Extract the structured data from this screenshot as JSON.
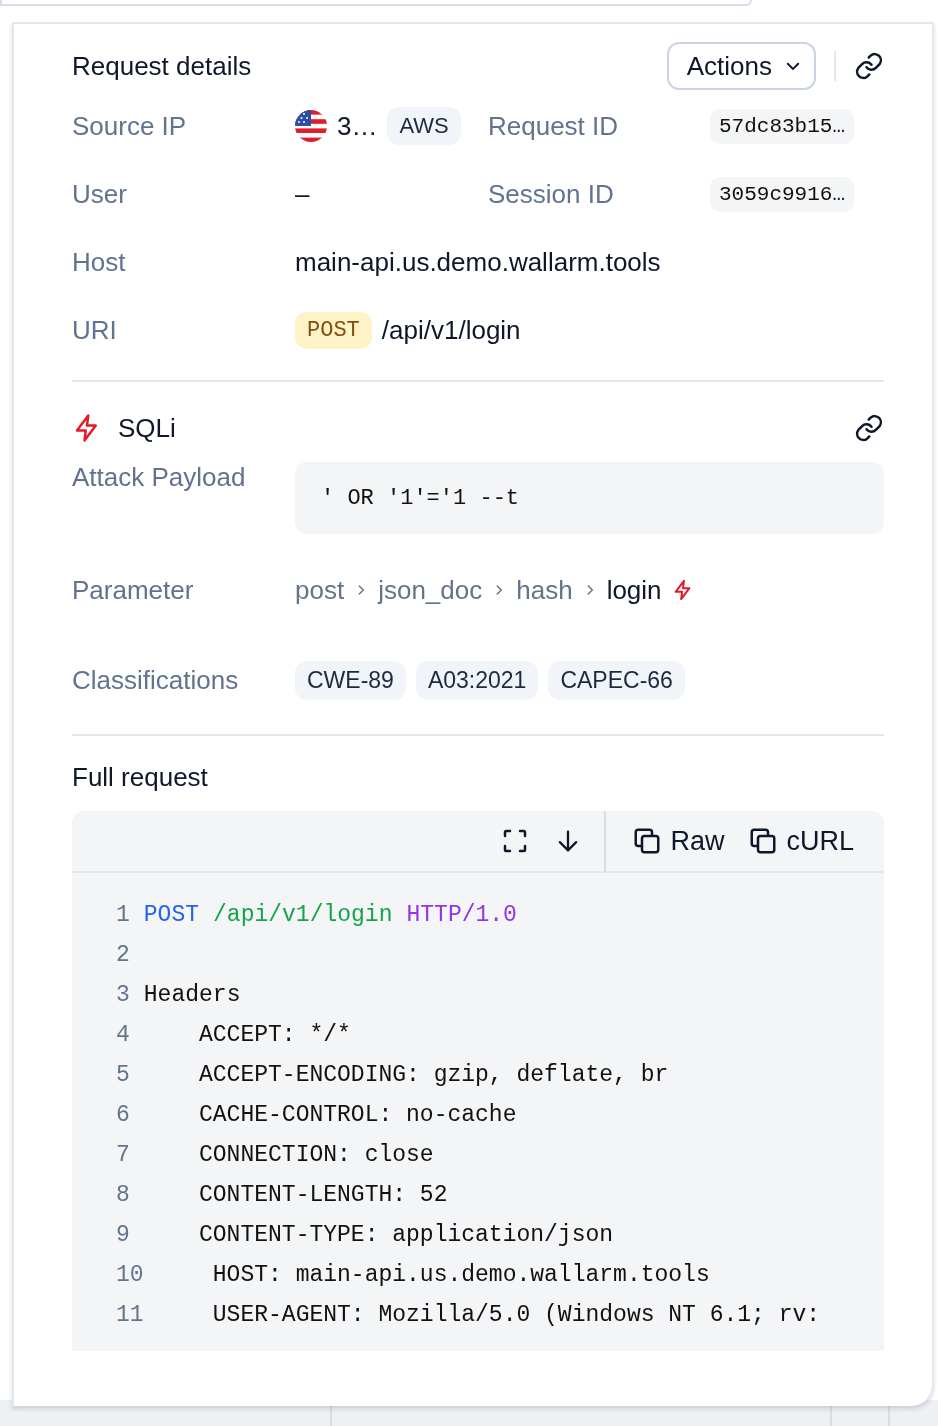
{
  "request_details": {
    "title": "Request details",
    "actions_button": "Actions"
  },
  "source_ip": {
    "label": "Source IP",
    "value": "3…",
    "provider": "AWS"
  },
  "request_id": {
    "label": "Request ID",
    "value": "57dc83b15…"
  },
  "user": {
    "label": "User",
    "value": "–"
  },
  "session_id": {
    "label": "Session ID",
    "value": "3059c9916…"
  },
  "host": {
    "label": "Host",
    "value": "main-api.us.demo.wallarm.tools"
  },
  "uri": {
    "label": "URI",
    "method": "POST",
    "path": "/api/v1/login"
  },
  "attack": {
    "type": "SQLi",
    "payload_label": "Attack Payload",
    "payload": "' OR '1'='1 --t",
    "parameter_label": "Parameter",
    "parameter_path": [
      {
        "text": "post",
        "attacked": false
      },
      {
        "text": "json_doc",
        "attacked": false
      },
      {
        "text": "hash",
        "attacked": false
      },
      {
        "text": "login",
        "attacked": true
      }
    ],
    "classifications_label": "Classifications",
    "classifications": [
      "CWE-89",
      "A03:2021",
      "CAPEC-66"
    ]
  },
  "full_request": {
    "title": "Full request",
    "buttons": [
      "Raw",
      "cURL"
    ],
    "lines": [
      {
        "number": "1",
        "tokens": [
          {
            "text": "POST",
            "kind": "method"
          },
          {
            "text": "/api/v1/login",
            "kind": "path"
          },
          {
            "text": "HTTP/1.0",
            "kind": "protocol"
          }
        ]
      },
      {
        "number": "2"
      },
      {
        "number": "3",
        "text": "Headers",
        "indented": false
      },
      {
        "number": "4",
        "text": "ACCEPT: */*",
        "indented": true
      },
      {
        "number": "5",
        "text": "ACCEPT-ENCODING: gzip, deflate, br",
        "indented": true
      },
      {
        "number": "6",
        "text": "CACHE-CONTROL: no-cache",
        "indented": true
      },
      {
        "number": "7",
        "text": "CONNECTION: close",
        "indented": true
      },
      {
        "number": "8",
        "text": "CONTENT-LENGTH: 52",
        "indented": true
      },
      {
        "number": "9",
        "text": "CONTENT-TYPE: application/json",
        "indented": true
      },
      {
        "number": "10",
        "text": "HOST: main-api.us.demo.wallarm.tools",
        "indented": true
      },
      {
        "number": "11",
        "text": "USER-AGENT: Mozilla/5.0 (Windows NT 6.1; rv:",
        "indented": true
      }
    ]
  }
}
